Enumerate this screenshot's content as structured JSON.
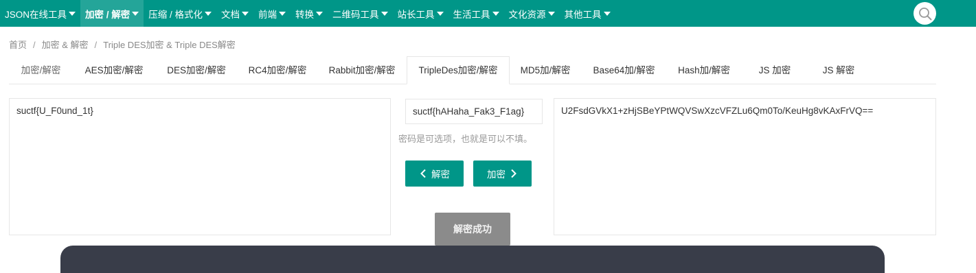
{
  "nav": {
    "items": [
      {
        "label": "JSON在线工具"
      },
      {
        "label": "加密 / 解密"
      },
      {
        "label": "压缩 / 格式化"
      },
      {
        "label": "文档"
      },
      {
        "label": "前端"
      },
      {
        "label": "转换"
      },
      {
        "label": "二维码工具"
      },
      {
        "label": "站长工具"
      },
      {
        "label": "生活工具"
      },
      {
        "label": "文化资源"
      },
      {
        "label": "其他工具"
      }
    ],
    "active_index": 1,
    "search_icon": "search-icon"
  },
  "breadcrumb": {
    "items": [
      "首页",
      "加密 & 解密",
      "Triple DES加密 & Triple DES解密"
    ],
    "separator": "/"
  },
  "tabs": {
    "items": [
      {
        "label": "加密/解密"
      },
      {
        "label": "AES加密/解密"
      },
      {
        "label": "DES加密/解密"
      },
      {
        "label": "RC4加密/解密"
      },
      {
        "label": "Rabbit加密/解密"
      },
      {
        "label": "TripleDes加密/解密"
      },
      {
        "label": "MD5加/解密"
      },
      {
        "label": "Base64加/解密"
      },
      {
        "label": "Hash加/解密"
      },
      {
        "label": "JS 加密"
      },
      {
        "label": "JS 解密"
      }
    ],
    "active_index": 5
  },
  "plaintext": {
    "value": "suctf{U_F0und_1t}"
  },
  "key": {
    "value": "suctf{hAHaha_Fak3_F1ag}",
    "hint": "密码是可选项，也就是可以不填。"
  },
  "ciphertext": {
    "value": "U2FsdGVkX1+zHjSBeYPtWQVSwXzcVFZLu6Qm0To/KeuHg8vKAxFrVQ=="
  },
  "buttons": {
    "decrypt": "解密",
    "encrypt": "加密"
  },
  "toast": {
    "message": "解密成功"
  },
  "colors": {
    "primary": "#009688",
    "toast": "#8b8b8b",
    "panel": "#393d49"
  }
}
